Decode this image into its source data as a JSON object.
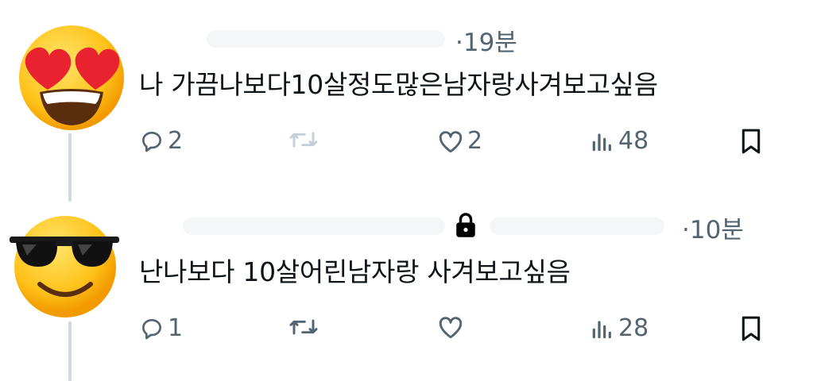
{
  "posts": [
    {
      "avatar": "heart-eyes-emoji",
      "time": "·19분",
      "text": "나 가끔나보다10살정도많은남자랑사겨보고싶음",
      "actions": {
        "replies": "2",
        "reposts": "",
        "likes": "2",
        "views": "48"
      }
    },
    {
      "avatar": "sunglasses-emoji",
      "time": "·10분",
      "text": "난나보다 10살어린남자랑 사겨보고싶음",
      "actions": {
        "replies": "1",
        "reposts": "",
        "likes": "",
        "views": "28"
      }
    }
  ],
  "colors": {
    "icon": "#536471",
    "text": "#0f1419",
    "thread_line": "#cfd9de",
    "repost_faded": "#c4cfd6"
  },
  "icons": [
    "reply-icon",
    "repost-icon",
    "like-icon",
    "views-icon",
    "bookmark-icon",
    "lock-icon"
  ]
}
